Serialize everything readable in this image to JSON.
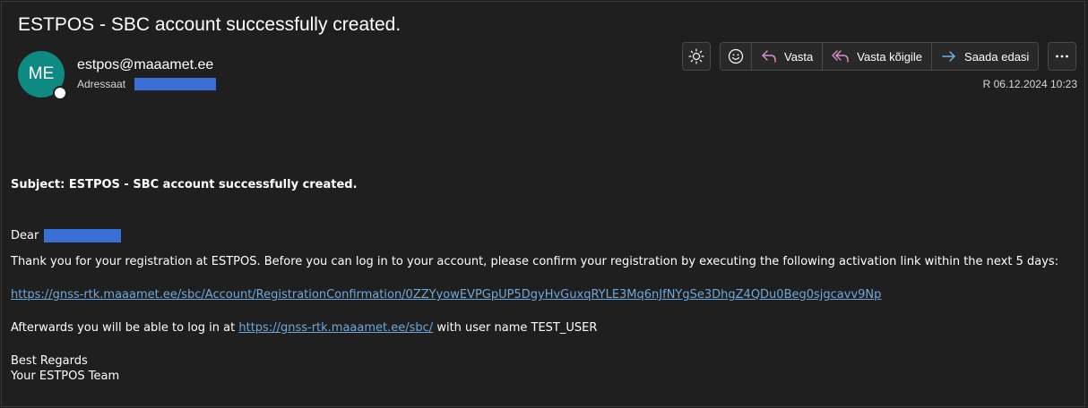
{
  "colors": {
    "background": "#1f1f1f",
    "avatar": "#0f8a83",
    "link": "#6fa8dc",
    "redaction": "#3a6fd6"
  },
  "mail": {
    "title": "ESTPOS - SBC account successfully created.",
    "avatar_initials": "ME",
    "sender": "estpos@maaamet.ee",
    "recipient_label": "Adressaat",
    "datetime": "R 06.12.2024 10:23"
  },
  "toolbar": {
    "brightness_icon": "sun-icon",
    "emoji_icon": "smiley-icon",
    "reply_label": "Vasta",
    "reply_all_label": "Vasta kõigile",
    "forward_label": "Saada edasi",
    "more_icon": "ellipsis-icon"
  },
  "body": {
    "subject": "Subject: ESTPOS - SBC account successfully created.",
    "greeting": "Dear",
    "paragraph1": "Thank you for your registration at ESTPOS. Before you can log in to your account, please confirm your registration by executing the following activation link within the next 5 days:",
    "activation_link": "https://gnss-rtk.maaamet.ee/sbc/Account/RegistrationConfirmation/0ZZYyowEVPGpUP5DgyHvGuxqRYLE3Mq6nJfNYgSe3DhgZ4QDu0Beg0sjgcavv9Np",
    "after_prefix": "Afterwards you will be able to log in at",
    "login_link": "https://gnss-rtk.maaamet.ee/sbc/",
    "after_suffix": "with user name TEST_USER",
    "closing": "Best Regards",
    "signature": "Your ESTPOS Team"
  }
}
